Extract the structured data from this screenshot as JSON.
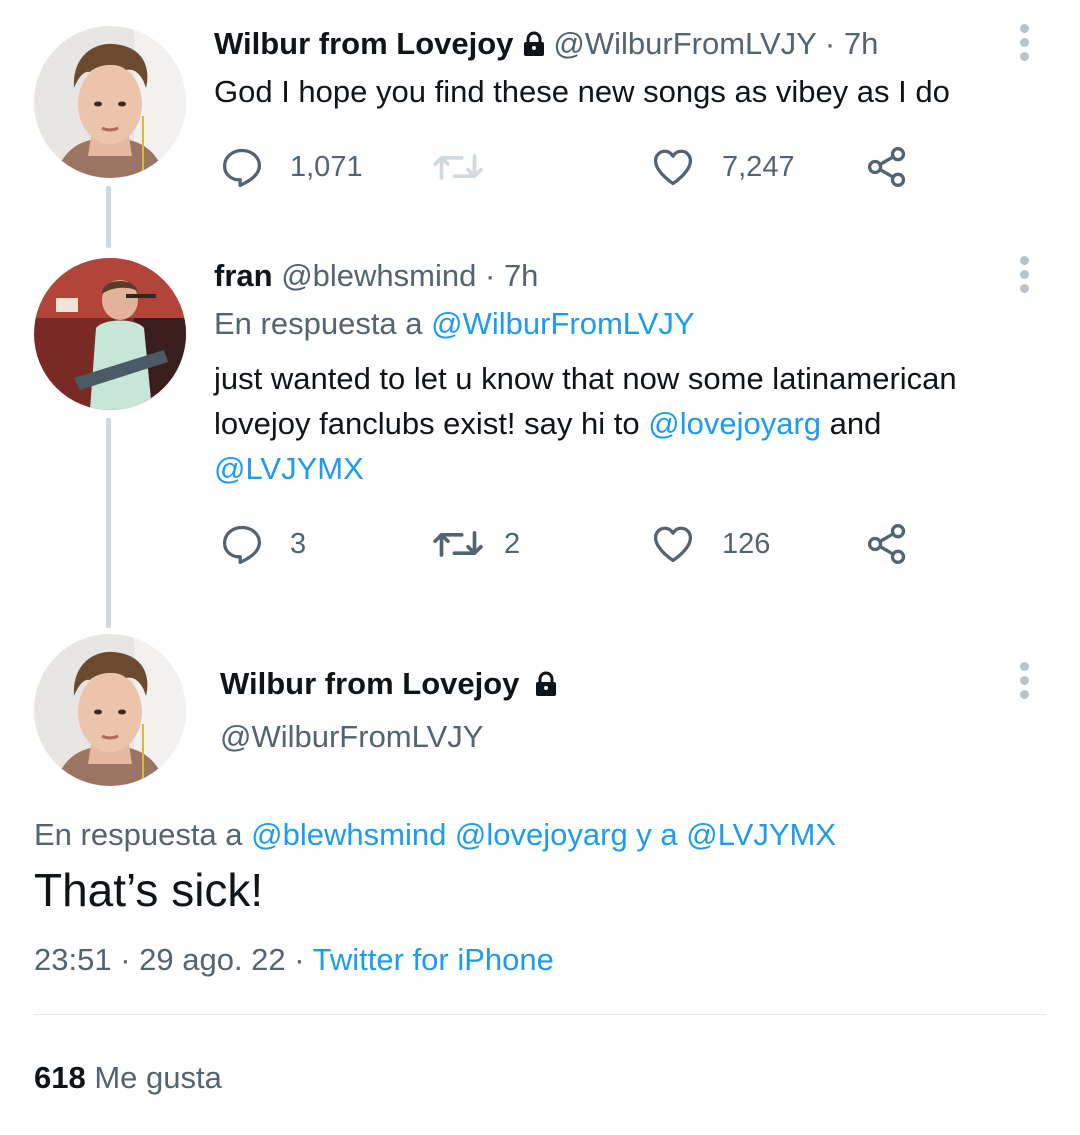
{
  "tweet1": {
    "name": "Wilbur from Lovejoy",
    "handle": "@WilburFromLVJY",
    "time": "7h",
    "text": "God I hope you find these new songs as vibey as I do",
    "replies": "1,071",
    "likes": "7,247"
  },
  "tweet2": {
    "name": "fran",
    "handle": "@blewhsmind",
    "time": "7h",
    "reply_prefix": "En respuesta a",
    "reply_to": "@WilburFromLVJY",
    "text_part1": "just wanted to let u know that now some latinamerican lovejoy fanclubs exist! say hi to",
    "mention1": "@lovejoyarg",
    "text_part2": "and",
    "mention2": "@LVJYMX",
    "replies": "3",
    "retweets": "2",
    "likes": "126"
  },
  "main_tweet": {
    "name": "Wilbur from Lovejoy",
    "handle": "@WilburFromLVJY",
    "reply_prefix": "En respuesta a",
    "reply_mentions": "@blewhsmind @lovejoyarg y a @LVJYMX",
    "text": "That’s sick!",
    "time": "23:51",
    "date": "29 ago. 22",
    "source": "Twitter for iPhone",
    "likes_count": "618",
    "likes_label": "Me gusta"
  },
  "icons": [
    "lock-icon",
    "more-icon",
    "reply-icon",
    "retweet-icon",
    "like-icon",
    "share-icon"
  ],
  "colors": {
    "link": "#1d9bf0",
    "muted": "#536471",
    "text": "#0f1419",
    "thread_line": "#cfd9de"
  }
}
